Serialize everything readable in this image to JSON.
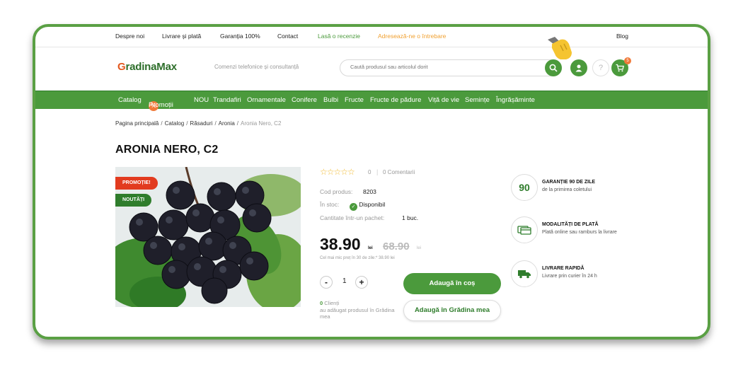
{
  "topnav": {
    "about": "Despre noi",
    "delivery": "Livrare și plată",
    "warranty": "Garanția 100%",
    "contact": "Contact",
    "review": "Lasă o recenzie",
    "question": "Adresează-ne o întrebare",
    "blog": "Blog"
  },
  "colors": {
    "brand_green": "#4b9a3c",
    "dark_green": "#2f7d2c",
    "orange": "#f07a3a",
    "promo_red": "#e23b1f"
  },
  "header": {
    "logo_g": "G",
    "logo_text": "radinaMax",
    "phone_text": "Comenzi telefonice și consultanță",
    "search_placeholder": "Caută produsul sau articolul dorit",
    "help": "?",
    "cart_count": "5"
  },
  "categories": [
    "Catalog",
    "Promoții",
    "NOU",
    "Trandafiri",
    "Ornamentale",
    "Conifere",
    "Bulbi",
    "Fructe",
    "Fructe de pădure",
    "Viță de vie",
    "Semințe",
    "Îngrășăminte"
  ],
  "promo_badge": "%",
  "breadcrumb": [
    "Pagina principală",
    "Catalog",
    "Răsaduri",
    "Aronia",
    "Aronia Nero, C2"
  ],
  "breadcrumb_sep": "/",
  "product": {
    "title": "ARONIA NERO, C2",
    "badge_promo": "PROMOȚIE!",
    "badge_new": "NOUTĂȚI",
    "stars": "☆☆☆☆☆",
    "rating_count": "0",
    "rating_sep": "|",
    "comments": "0 Comentarii",
    "code_label": "Cod produs:",
    "code_value": "8203",
    "stock_label": "În stoc:",
    "stock_value": "Disponibil",
    "pack_label": "Cantitate într-un pachet:",
    "pack_value": "1 buc.",
    "price": "38.90",
    "currency": "lei",
    "old_price": "68.90",
    "old_currency": "lei",
    "lowest_price": "Cel mai mic preț în 30 de zile:* 38.90 lei",
    "qty_minus": "-",
    "qty": "1",
    "qty_plus": "+",
    "add_cart": "Adaugă în coș",
    "add_garden": "Adaugă în Grădina mea",
    "clients_count": "0",
    "clients_label": "Clienți",
    "clients_text": "au adăugat produsul în Grădina mea"
  },
  "features": [
    {
      "icon": "90",
      "title": "GARANȚIE 90 DE ZILE",
      "desc": "de la primirea coletului"
    },
    {
      "icon": "card-icon",
      "title": "MODALITĂȚI DE PLATĂ",
      "desc": "Plată online sau ramburs la livrare"
    },
    {
      "icon": "truck-icon",
      "title": "LIVRARE RAPIDĂ",
      "desc": "Livrare prin curier în 24 h"
    }
  ]
}
